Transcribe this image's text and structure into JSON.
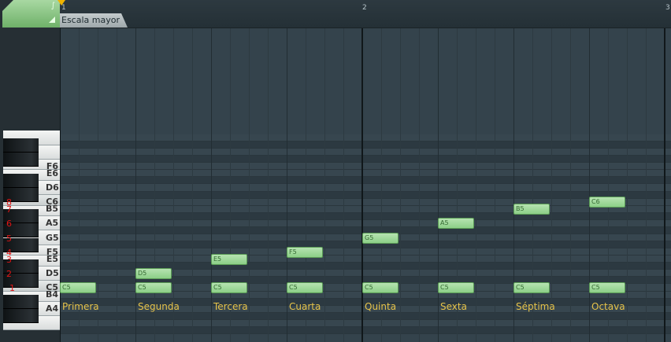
{
  "pattern_name": "Escala mayor",
  "ruler": [
    "1",
    "2",
    "3"
  ],
  "keys": {
    "white": [
      "F6",
      "E6",
      "D6",
      "C6",
      "B5",
      "A5",
      "G5",
      "F5",
      "E5",
      "D5",
      "C5",
      "B4",
      "A4"
    ]
  },
  "degrees": [
    "8",
    "7",
    "6",
    "5",
    "4",
    "3",
    "2",
    "1"
  ],
  "notes": [
    {
      "pitch": "C5",
      "label": "C5",
      "step": 0
    },
    {
      "pitch": "C5",
      "label": "C5",
      "step": 4
    },
    {
      "pitch": "D5",
      "label": "D5",
      "step": 4
    },
    {
      "pitch": "C5",
      "label": "C5",
      "step": 8
    },
    {
      "pitch": "E5",
      "label": "E5",
      "step": 8
    },
    {
      "pitch": "C5",
      "label": "C5",
      "step": 12
    },
    {
      "pitch": "F5",
      "label": "F5",
      "step": 12
    },
    {
      "pitch": "C5",
      "label": "C5",
      "step": 16
    },
    {
      "pitch": "G5",
      "label": "G5",
      "step": 16
    },
    {
      "pitch": "C5",
      "label": "C5",
      "step": 20
    },
    {
      "pitch": "A5",
      "label": "A5",
      "step": 20
    },
    {
      "pitch": "C5",
      "label": "C5",
      "step": 24
    },
    {
      "pitch": "B5",
      "label": "B5",
      "step": 24
    },
    {
      "pitch": "C5",
      "label": "C5",
      "step": 28
    },
    {
      "pitch": "C6",
      "label": "C6",
      "step": 28
    }
  ],
  "intervals": [
    "Primera",
    "Segunda",
    "Tercera",
    "Cuarta",
    "Quinta",
    "Sexta",
    "Séptima",
    "Octava"
  ],
  "colors": {
    "note_fill": "#9fd89a",
    "degree_text": "#e21414",
    "interval_text": "#e6c34a",
    "corner_accent": "#7dbf77"
  }
}
